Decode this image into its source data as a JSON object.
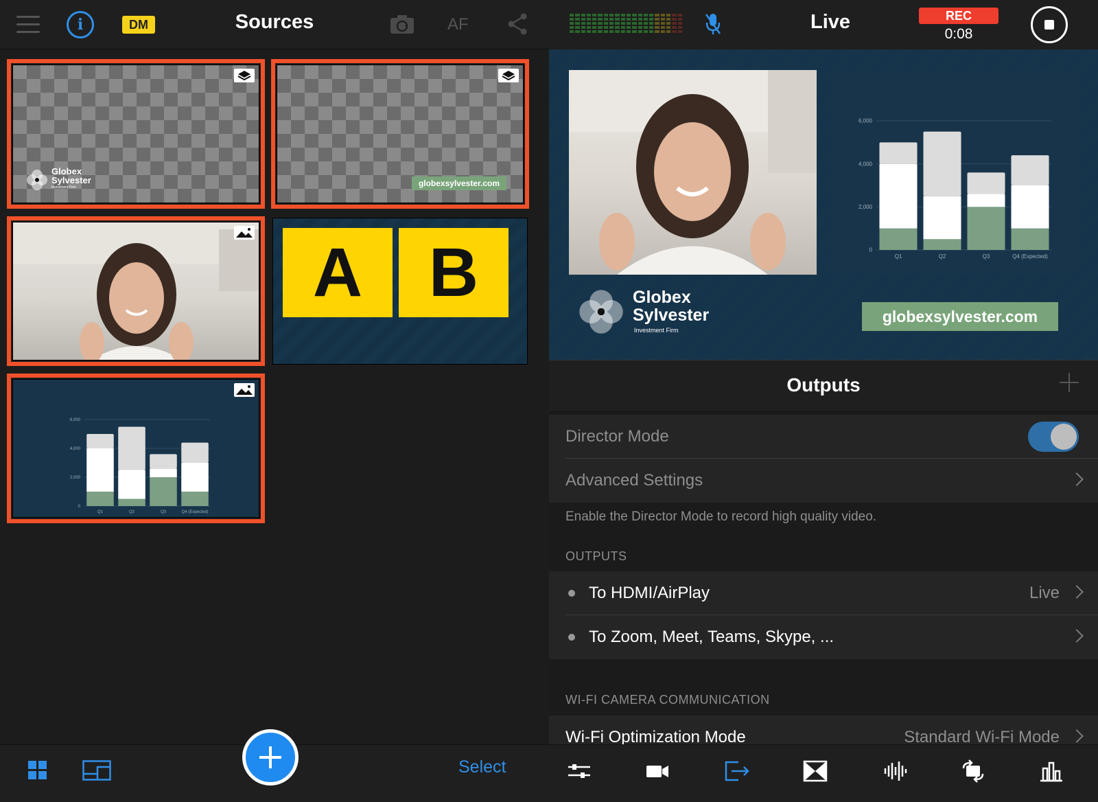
{
  "sources_panel": {
    "title": "Sources",
    "dm_badge": "DM",
    "af_label": "AF",
    "tiles": [
      {
        "kind": "overlay",
        "selected": true,
        "logo_name": "Globex Sylvester",
        "logo_sub": "Investment Firm"
      },
      {
        "kind": "overlay",
        "selected": true,
        "url": "globexsylvester.com"
      },
      {
        "kind": "image",
        "selected": true
      },
      {
        "kind": "ab",
        "selected": false,
        "a_label": "A",
        "b_label": "B"
      },
      {
        "kind": "chart",
        "selected": true
      }
    ],
    "select_label": "Select",
    "icons": [
      "menu-icon",
      "info-icon",
      "camera-switch-icon",
      "share-icon",
      "grid-view-icon",
      "layout-view-icon",
      "add-icon"
    ]
  },
  "live_panel": {
    "title": "Live",
    "rec_label": "REC",
    "rec_time": "0:08",
    "preview": {
      "logo_line1": "Globex",
      "logo_line2": "Sylvester",
      "logo_sub": "Investment Firm",
      "url": "globexsylvester.com"
    }
  },
  "chart_data": {
    "type": "bar",
    "stacked": true,
    "categories": [
      "Q1",
      "Q2",
      "Q3",
      "Q4 (Expected)"
    ],
    "series": [
      {
        "values": [
          1000,
          500,
          2000,
          1000
        ],
        "color": "#7d9f84"
      },
      {
        "values": [
          3000,
          2000,
          600,
          2000
        ],
        "color": "#ffffff"
      },
      {
        "values": [
          1000,
          3000,
          1000,
          1400
        ],
        "color": "#dcdcdc"
      }
    ],
    "yticks": [
      "0",
      "2,000",
      "4,000",
      "6,000"
    ],
    "ylim": [
      0,
      6000
    ]
  },
  "outputs": {
    "title": "Outputs",
    "director_mode_label": "Director Mode",
    "director_mode_on": true,
    "advanced_label": "Advanced Settings",
    "footnote": "Enable the Director Mode to record high quality video.",
    "outputs_section": "OUTPUTS",
    "items": [
      {
        "label": "To HDMI/AirPlay",
        "value": "Live"
      },
      {
        "label": "To Zoom, Meet, Teams, Skype, ...",
        "value": ""
      }
    ],
    "wifi_section": "WI-FI CAMERA COMMUNICATION",
    "wifi_label": "Wi-Fi Optimization Mode",
    "wifi_value": "Standard Wi-Fi Mode"
  },
  "colors": {
    "accent": "#1f8bf0",
    "selection": "#f0512a",
    "rec": "#ef3d2e",
    "brand_green": "#79a47a",
    "navy": "#18344a",
    "yellow": "#ffd400"
  }
}
